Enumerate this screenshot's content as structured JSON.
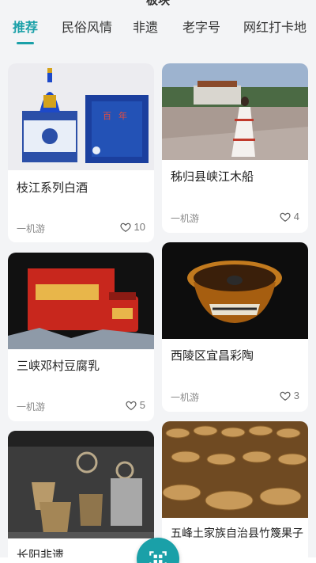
{
  "header": {
    "title": "板块"
  },
  "tabs": [
    {
      "label": "推荐",
      "active": true
    },
    {
      "label": "民俗风情",
      "active": false
    },
    {
      "label": "非遗",
      "active": false
    },
    {
      "label": "老字号",
      "active": false
    },
    {
      "label": "网红打卡地",
      "active": false
    }
  ],
  "cards": [
    {
      "title": "枝江系列白酒",
      "source": "一机游",
      "likes": "10",
      "image": "liquor-bottle-and-box"
    },
    {
      "title": "秭归县峡江木船",
      "source": "一机游",
      "likes": "4",
      "image": "woman-in-white-dress-at-plaza"
    },
    {
      "title": "三峡邓村豆腐乳",
      "source": "一机游",
      "likes": "5",
      "image": "red-gift-box-and-jar"
    },
    {
      "title": "西陵区宜昌彩陶",
      "source": "一机游",
      "likes": "3",
      "image": "glazed-pottery-bowl"
    },
    {
      "title": "长阳非遗",
      "source": "",
      "likes": "",
      "image": "woven-baskets-exhibit"
    },
    {
      "title": "五峰土家族自治县竹篾果子",
      "source": "",
      "likes": "",
      "image": "bamboo-baskets"
    }
  ],
  "colors": {
    "accent": "#1aa0a8",
    "background": "#f3f4f6"
  },
  "fab": {
    "icon": "scan-icon"
  }
}
